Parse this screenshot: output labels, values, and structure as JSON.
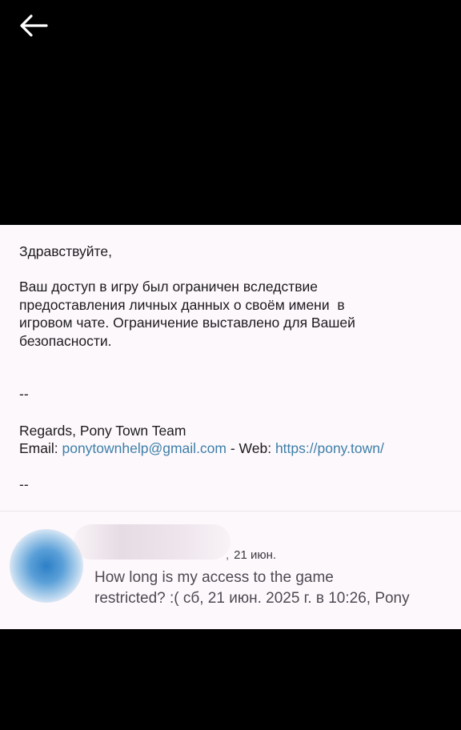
{
  "toolbar": {
    "back_icon": "arrow-left-icon"
  },
  "email": {
    "greeting": "Здравствуйте,",
    "message_lines": [
      "Ваш доступ в игру был ограничен вследствие",
      "предоставления личных данных о своём имени  в",
      "игровом чате. Ограничение выставлено для Вашей",
      "безопасности."
    ],
    "signature_separator": "--",
    "regards": "Regards, Pony Town Team",
    "email_label": "Email: ",
    "email_address": "ponytownhelp@gmail.com",
    "web_label": " - Web: ",
    "web_url": "https://pony.town/",
    "signature_separator_2": "--"
  },
  "reply": {
    "avatar_icon": "avatar-icon",
    "sender_partial": ",",
    "date": "21 июн.",
    "preview_line_1": "How long is my access to the game",
    "preview_line_2": "restricted? :( сб, 21 июн. 2025 г. в 10:26, Pony"
  },
  "colors": {
    "background": "#000000",
    "card": "#fdf8fc",
    "link": "#3d7fa8",
    "text": "#1c1b1f",
    "avatar": "#2d7fc6"
  }
}
